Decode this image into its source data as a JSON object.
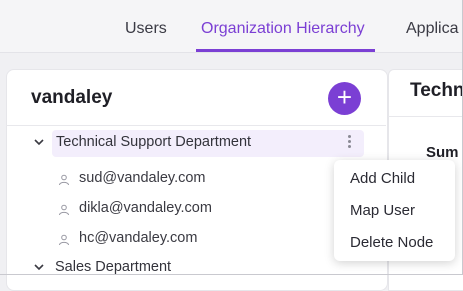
{
  "tabs": [
    {
      "label": "Users"
    },
    {
      "label": "Organization Hierarchy",
      "active": true
    },
    {
      "label": "Applica"
    }
  ],
  "org": {
    "name": "vandaley",
    "add_button": "+"
  },
  "tree": {
    "nodes": [
      {
        "label": "Technical Support Department",
        "expanded": true,
        "selected": true
      },
      {
        "label": "Sales Department",
        "expanded": true
      }
    ],
    "users": [
      {
        "email": "sud@vandaley.com"
      },
      {
        "email": "dikla@vandaley.com"
      },
      {
        "email": "hc@vandaley.com"
      }
    ]
  },
  "context_menu": {
    "items": [
      {
        "label": "Add Child"
      },
      {
        "label": "Map User"
      },
      {
        "label": "Delete Node"
      }
    ]
  },
  "detail_panel": {
    "title": "Techn",
    "section": "Sum"
  },
  "colors": {
    "accent": "#7b3fd4",
    "selected_row_bg": "#f3eefc"
  },
  "icons": {
    "add": "plus-icon",
    "more": "kebab-icon",
    "expand": "chevron-down-icon",
    "user": "user-icon"
  }
}
